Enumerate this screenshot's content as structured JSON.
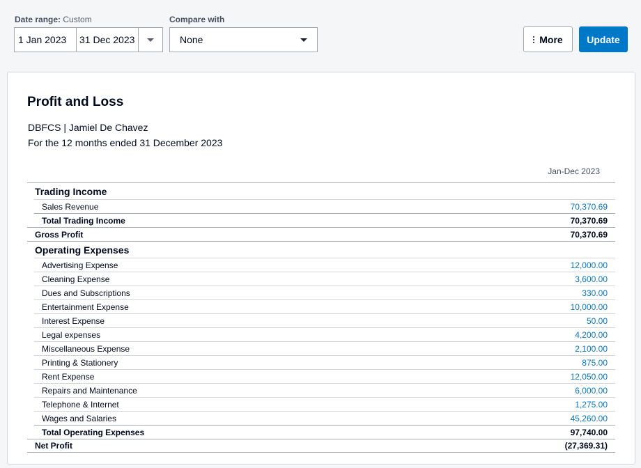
{
  "filters": {
    "date_range_label": "Date range:",
    "date_range_mode": "Custom",
    "start_date": "1 Jan 2023",
    "end_date": "31 Dec 2023",
    "compare_label": "Compare with",
    "compare_value": "None"
  },
  "actions": {
    "more_label": "More",
    "update_label": "Update"
  },
  "report": {
    "title": "Profit and Loss",
    "organisation": "DBFCS | Jamiel De Chavez",
    "period": "For the 12 months ended 31 December 2023",
    "column_header": "Jan-Dec 2023",
    "trading_income": {
      "heading": "Trading Income",
      "items": [
        {
          "label": "Sales Revenue",
          "value": "70,370.69"
        }
      ],
      "total_label": "Total Trading Income",
      "total_value": "70,370.69"
    },
    "gross_profit": {
      "label": "Gross Profit",
      "value": "70,370.69"
    },
    "operating_expenses": {
      "heading": "Operating Expenses",
      "items": [
        {
          "label": "Advertising Expense",
          "value": "12,000.00"
        },
        {
          "label": "Cleaning Expense",
          "value": "3,600.00"
        },
        {
          "label": "Dues and Subscriptions",
          "value": "330.00"
        },
        {
          "label": "Entertainment Expense",
          "value": "10,000.00"
        },
        {
          "label": "Interest Expense",
          "value": "50.00"
        },
        {
          "label": "Legal expenses",
          "value": "4,200.00"
        },
        {
          "label": "Miscellaneous Expense",
          "value": "2,100.00"
        },
        {
          "label": "Printing & Stationery",
          "value": "875.00"
        },
        {
          "label": "Rent Expense",
          "value": "12,050.00"
        },
        {
          "label": "Repairs and Maintenance",
          "value": "6,000.00"
        },
        {
          "label": "Telephone & Internet",
          "value": "1,275.00"
        },
        {
          "label": "Wages and Salaries",
          "value": "45,260.00"
        }
      ],
      "total_label": "Total Operating Expenses",
      "total_value": "97,740.00"
    },
    "net_profit": {
      "label": "Net Profit",
      "value": "(27,369.31)"
    }
  },
  "colors": {
    "accent": "#0078c8",
    "text": "#000a1e",
    "border": "#a3a9b1"
  }
}
